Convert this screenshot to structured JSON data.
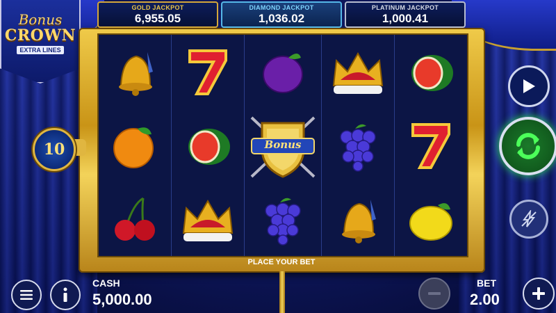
{
  "logo": {
    "line1": "Bonus",
    "line2": "CROWN",
    "line3": "EXTRA LINES"
  },
  "jackpots": [
    {
      "label": "GOLD JACKPOT",
      "value": "6,955.05"
    },
    {
      "label": "DIAMOND JACKPOT",
      "value": "1,036.02"
    },
    {
      "label": "PLATINUM JACKPOT",
      "value": "1,000.41"
    }
  ],
  "lines": "10",
  "reels": [
    [
      "bell",
      "orange",
      "cherry"
    ],
    [
      "seven",
      "watermelon",
      "crown"
    ],
    [
      "plum",
      "bonus-shield",
      "grapes"
    ],
    [
      "crown",
      "grapes",
      "bell"
    ],
    [
      "watermelon",
      "seven",
      "lemon"
    ]
  ],
  "bonus_label": "Bonus",
  "status": "PLACE YOUR BET",
  "cash": {
    "label": "CASH",
    "value": "5,000.00"
  },
  "bet": {
    "label": "BET",
    "value": "2.00"
  },
  "icons": {
    "menu": "menu-icon",
    "info": "info-icon",
    "play": "play-icon",
    "spin": "spin-icon",
    "turbo": "lightning-icon",
    "minus": "minus-icon",
    "plus": "plus-icon"
  },
  "colors": {
    "frame_gold": "#e0b640",
    "spin_green": "#2fe04a",
    "reel_bg": "#0c1545"
  }
}
